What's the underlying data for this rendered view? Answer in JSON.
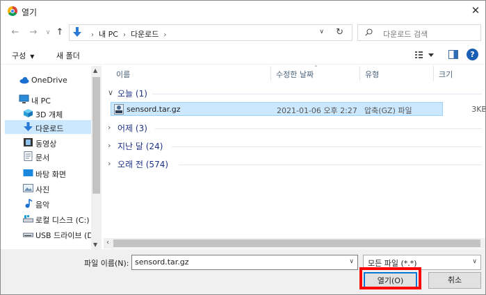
{
  "window": {
    "title": "열기",
    "close": "✕"
  },
  "address": {
    "crumbs": [
      "내 PC",
      "다운로드"
    ],
    "separator": "›",
    "search_placeholder": "다운로드 검색"
  },
  "toolbar": {
    "organize": "구성",
    "new_folder": "새 폴더",
    "help": "?"
  },
  "nav": {
    "items": [
      {
        "label": "OneDrive",
        "icon": "cloud-icon"
      },
      {
        "label": "내 PC",
        "icon": "computer-icon"
      },
      {
        "label": "3D 개체",
        "icon": "cube-icon"
      },
      {
        "label": "다운로드",
        "icon": "download-icon",
        "selected": true
      },
      {
        "label": "동영상",
        "icon": "film-icon"
      },
      {
        "label": "문서",
        "icon": "document-icon"
      },
      {
        "label": "바탕 화면",
        "icon": "desktop-icon"
      },
      {
        "label": "사진",
        "icon": "picture-icon"
      },
      {
        "label": "음악",
        "icon": "music-icon"
      },
      {
        "label": "로컬 디스크 (C:)",
        "icon": "drive-icon"
      },
      {
        "label": "USB 드라이브 (D",
        "icon": "usb-drive-icon"
      }
    ]
  },
  "columns": {
    "name": "이름",
    "modified": "수정한 날짜",
    "type": "유형",
    "size": "크기"
  },
  "groups": {
    "today": "오늘 (1)",
    "yesterday": "어제 (3)",
    "last_month": "지난 달 (24)",
    "long_ago": "오래 전 (574)"
  },
  "files": [
    {
      "name": "sensord.tar.gz",
      "modified": "2021-01-06 오후 2:27",
      "type": "압축(GZ) 파일",
      "size": "3KB"
    }
  ],
  "bottom": {
    "filename_label": "파일 이름(N):",
    "filename_value": "sensord.tar.gz",
    "filetype_value": "모든 파일 (*.*)",
    "open_button": "열기(O)",
    "cancel_button": "취소"
  },
  "colors": {
    "selection": "#cce8ff",
    "accent": "#0078d7",
    "highlight": "#ff0000",
    "group_text": "#1e3287"
  }
}
